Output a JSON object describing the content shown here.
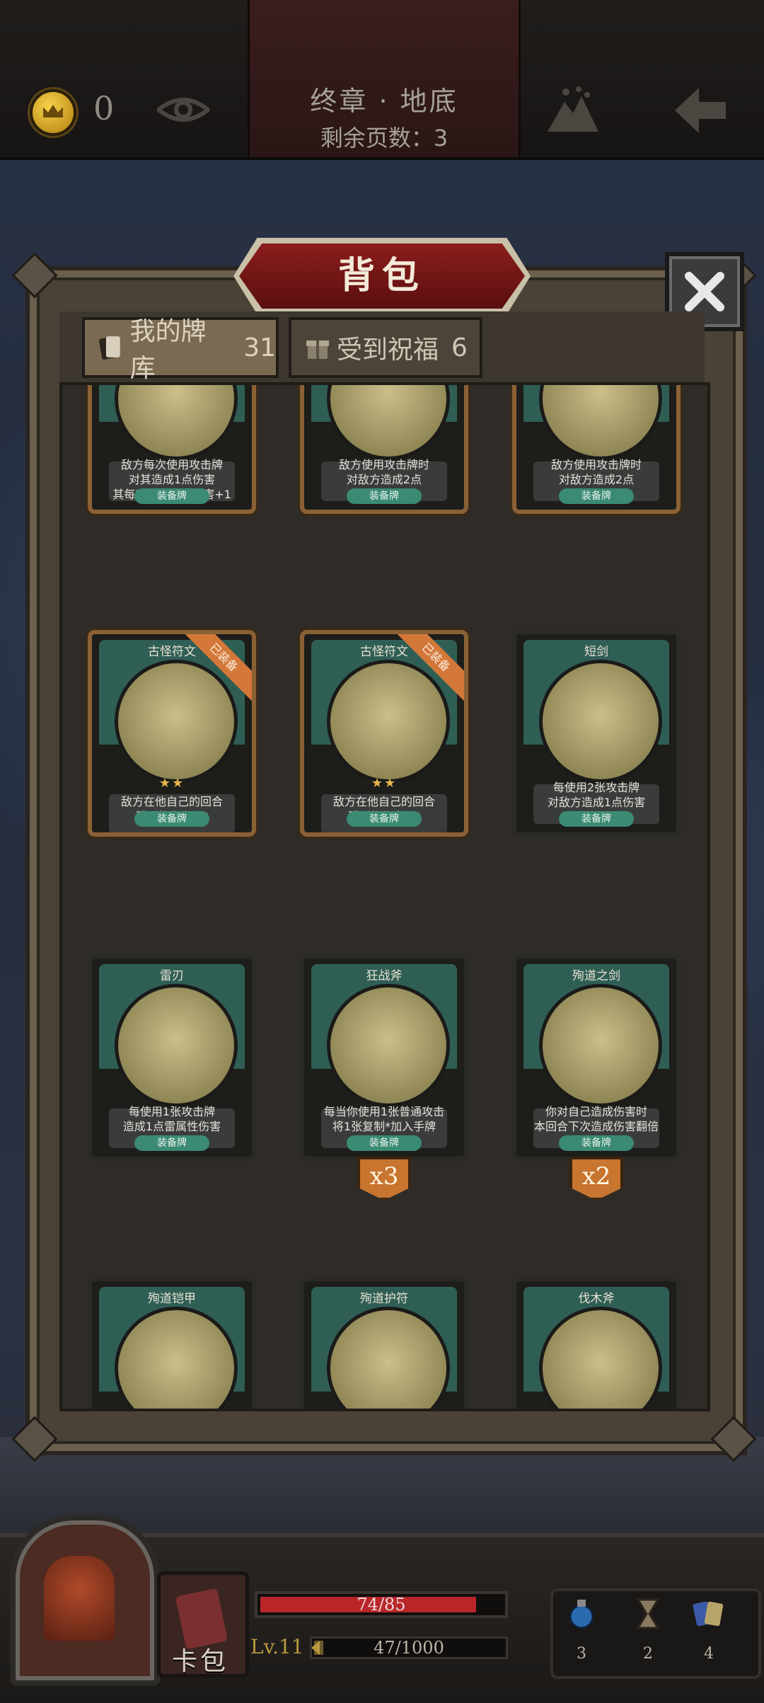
{
  "header": {
    "chapter_title": "终章 · 地底",
    "pages_left": "剩余页数：3",
    "coins": "0"
  },
  "bag": {
    "title": "背包",
    "tabs": [
      {
        "label": "我的牌库",
        "count": "31"
      },
      {
        "label": "受到祝福",
        "count": "6"
      }
    ]
  },
  "cards": [
    {
      "name": "",
      "desc": "敌方每次使用攻击牌\n对其造成1点伤害\n其每有一张手牌伤害+1",
      "type": "装备牌",
      "equipped": true,
      "stars": "",
      "multiplier": ""
    },
    {
      "name": "",
      "desc": "敌方使用攻击牌时\n对敌方造成2点\n火属性伤害",
      "type": "装备牌",
      "equipped": true,
      "stars": "",
      "multiplier": ""
    },
    {
      "name": "",
      "desc": "敌方使用攻击牌时\n对敌方造成2点\n火属性伤害",
      "type": "装备牌",
      "equipped": true,
      "stars": "",
      "multiplier": ""
    },
    {
      "name": "古怪符文",
      "desc": "敌方在他自己的回合\n受到的伤害+3",
      "type": "装备牌",
      "equipped": true,
      "ribbon": "已装备",
      "stars": "★★",
      "multiplier": ""
    },
    {
      "name": "古怪符文",
      "desc": "敌方在他自己的回合\n受到的伤害+3",
      "type": "装备牌",
      "equipped": true,
      "ribbon": "已装备",
      "stars": "★★",
      "multiplier": ""
    },
    {
      "name": "短剑",
      "desc": "每使用2张攻击牌\n对敌方造成1点伤害",
      "type": "装备牌",
      "equipped": false,
      "stars": "",
      "multiplier": ""
    },
    {
      "name": "雷刃",
      "desc": "每使用1张攻击牌\n造成1点雷属性伤害",
      "type": "装备牌",
      "equipped": false,
      "stars": "",
      "multiplier": ""
    },
    {
      "name": "狂战斧",
      "desc": "每当你使用1张普通攻击\n将1张复制*加入手牌",
      "type": "装备牌",
      "equipped": false,
      "stars": "",
      "multiplier": "x3"
    },
    {
      "name": "殉道之剑",
      "desc": "你对自己造成伤害时\n本回合下次造成伤害翻倍",
      "type": "装备牌",
      "equipped": false,
      "stars": "",
      "multiplier": "x2"
    },
    {
      "name": "殉道铠甲",
      "desc": "",
      "type": "",
      "equipped": false,
      "stars": "",
      "multiplier": ""
    },
    {
      "name": "殉道护符",
      "desc": "",
      "type": "",
      "equipped": false,
      "stars": "",
      "multiplier": ""
    },
    {
      "name": "伐木斧",
      "desc": "",
      "type": "",
      "equipped": false,
      "stars": "",
      "multiplier": ""
    }
  ],
  "footer": {
    "deck_label": "卡包",
    "hp_text": "74/85",
    "hp_fraction": 0.87,
    "level": "Lv.11",
    "xp_text": "47/1000",
    "xp_fraction": 0.047,
    "items": [
      {
        "icon": "potion-icon",
        "count": "3"
      },
      {
        "icon": "hourglass-icon",
        "count": "2"
      },
      {
        "icon": "cards-icon",
        "count": "4"
      }
    ]
  },
  "colors": {
    "equipped_border": "#8a6136",
    "card_top": "#2f5e55",
    "hp_fill": "#b8262a",
    "banner": "#8c1d1d"
  }
}
